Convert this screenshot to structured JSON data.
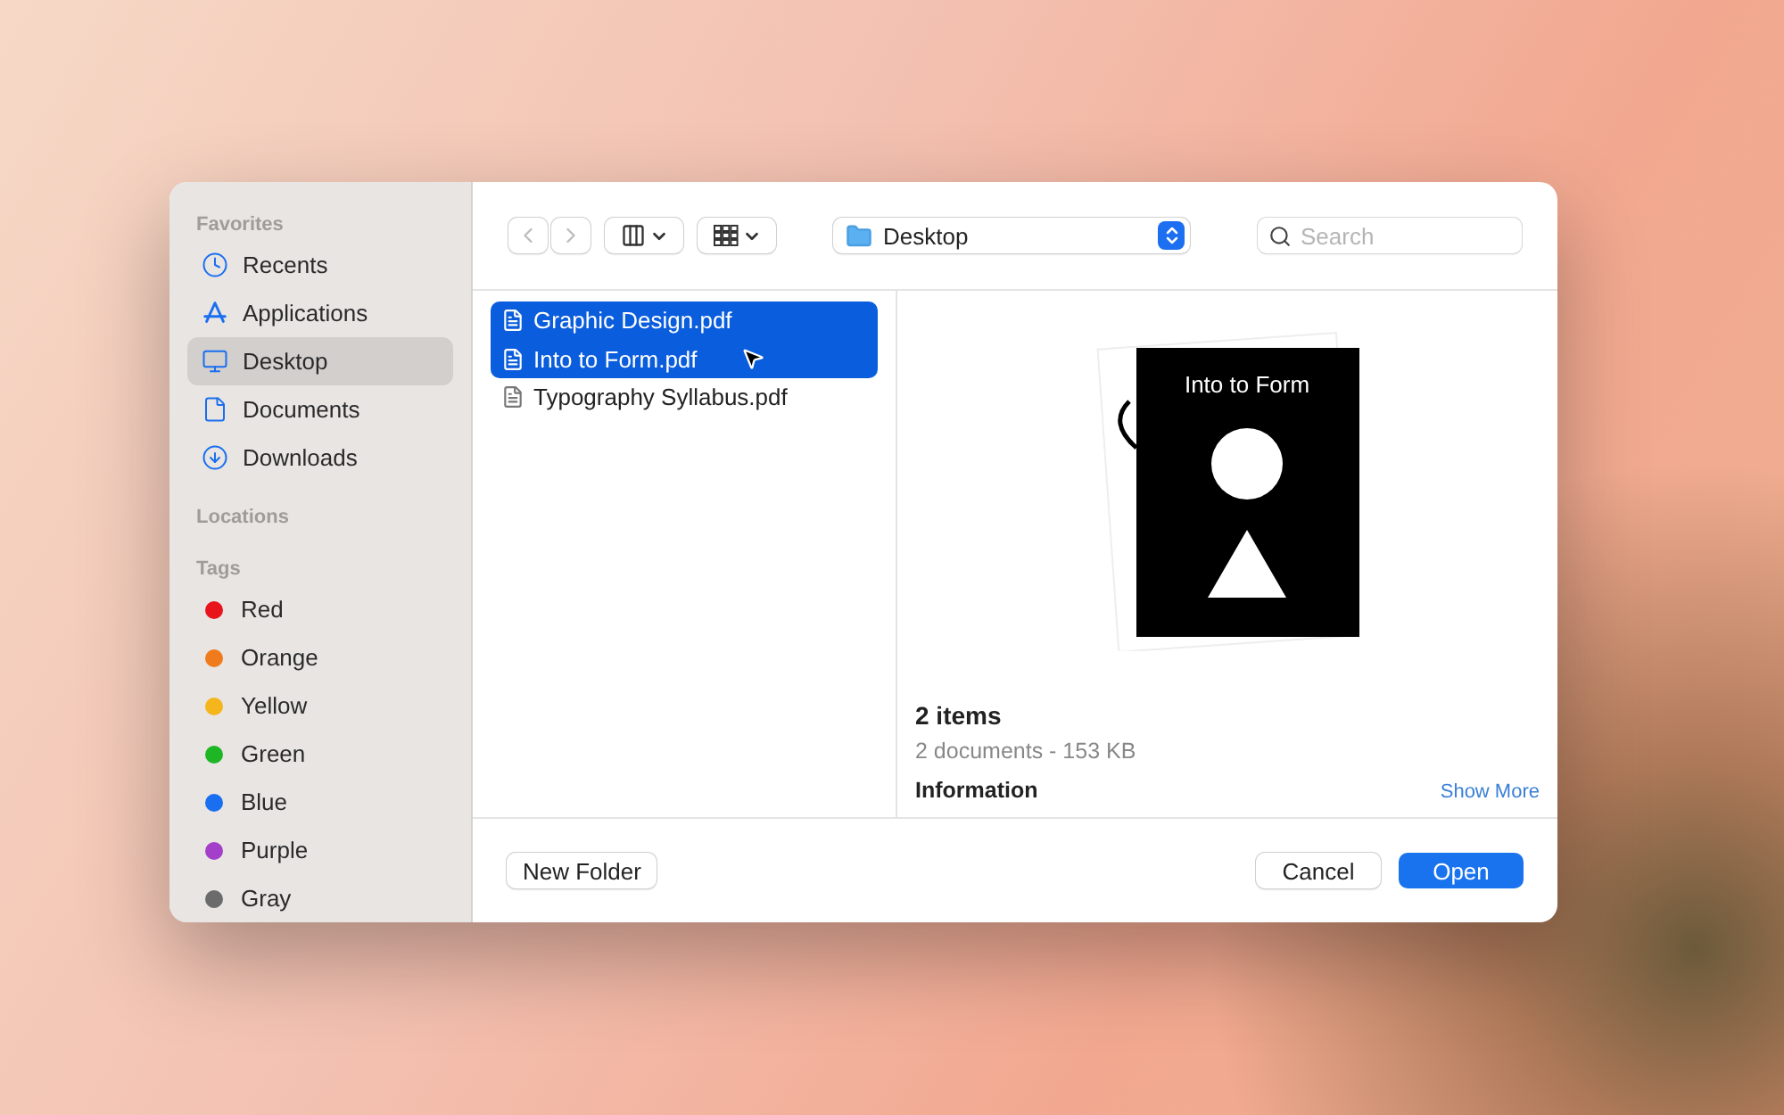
{
  "sidebar": {
    "sections": [
      {
        "title": "Favorites",
        "items": [
          {
            "label": "Recents",
            "kind": "recents",
            "selected": false
          },
          {
            "label": "Applications",
            "kind": "applications",
            "selected": false
          },
          {
            "label": "Desktop",
            "kind": "desktop",
            "selected": true
          },
          {
            "label": "Documents",
            "kind": "documents",
            "selected": false
          },
          {
            "label": "Downloads",
            "kind": "downloads",
            "selected": false
          }
        ]
      },
      {
        "title": "Locations"
      },
      {
        "title": "Tags",
        "tags": [
          {
            "label": "Red",
            "color": "#e8141c"
          },
          {
            "label": "Orange",
            "color": "#f07b1d"
          },
          {
            "label": "Yellow",
            "color": "#f5b51c"
          },
          {
            "label": "Green",
            "color": "#1fb626"
          },
          {
            "label": "Blue",
            "color": "#1a6ff0"
          },
          {
            "label": "Purple",
            "color": "#a33fc9"
          },
          {
            "label": "Gray",
            "color": "#6b6b6b"
          }
        ]
      }
    ]
  },
  "toolbar": {
    "location": "Desktop",
    "search": {
      "placeholder": "Search"
    }
  },
  "files": [
    {
      "name": "Graphic Design.pdf",
      "selected": true
    },
    {
      "name": "Into to Form.pdf",
      "selected": true
    },
    {
      "name": "Typography Syllabus.pdf",
      "selected": false
    }
  ],
  "preview": {
    "cover_title": "Into to Form",
    "count": "2 items",
    "details": "2 documents - 153 KB",
    "info_label": "Information",
    "show_more": "Show More"
  },
  "buttons": {
    "new_folder": "New Folder",
    "cancel": "Cancel",
    "open": "Open"
  }
}
